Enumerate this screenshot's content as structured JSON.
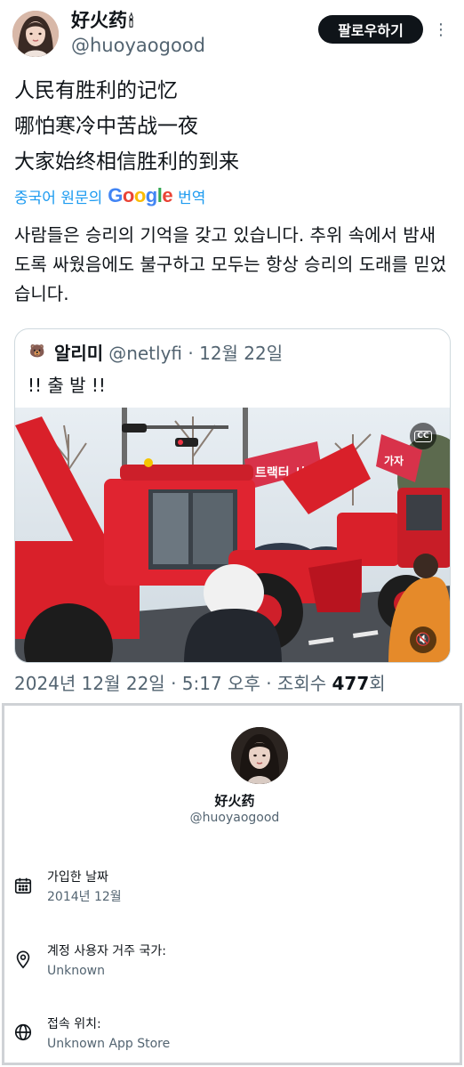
{
  "tweet": {
    "display_name": "好火药",
    "name_emoji": "🕯",
    "handle": "@huoyaogood",
    "follow_label": "팔로우하기",
    "more_glyph": "⋮",
    "original_lines": [
      "人民有胜利的记忆",
      "哪怕寒冷中苦战一夜",
      "大家始终相信胜利的到来"
    ],
    "translate_prefix": "중국어 원문의",
    "translate_logo": "Google",
    "translate_suffix": "번역",
    "translated_text": "사람들은 승리의 기억을 갖고 있습니다. 추위 속에서 밤새도록 싸웠음에도 불구하고 모두는 항상 승리의 도래를 믿었습니다.",
    "quote": {
      "avatar_glyph": "🐻",
      "name": "알리미",
      "handle_date": "@netlyfi · 12월 22일",
      "text": "!! 출 발 !!",
      "media": {
        "cc_label": "CC",
        "mute_glyph": "🔇",
        "banner_left": "트랙터 시위",
        "banner_right": "가자"
      }
    },
    "meta": {
      "date": "2024년 12월 22일 · 5:17 오후 · 조회수 ",
      "views": "477",
      "views_unit": "회"
    }
  },
  "profile": {
    "display_name": "好火药",
    "handle": "@huoyaogood",
    "rows": [
      {
        "icon": "calendar-icon",
        "label": "가입한 날짜",
        "value": "2014년 12월"
      },
      {
        "icon": "location-pin-icon",
        "label": "계정 사용자 거주 국가:",
        "value": "Unknown"
      },
      {
        "icon": "globe-icon",
        "label": "접속 위치:",
        "value": "Unknown App Store"
      }
    ]
  },
  "colors": {
    "accent": "#1d9bf0",
    "text": "#0f1419",
    "muted": "#536471",
    "follow_bg": "#0f1419",
    "tractor_red": "#d9202a"
  }
}
